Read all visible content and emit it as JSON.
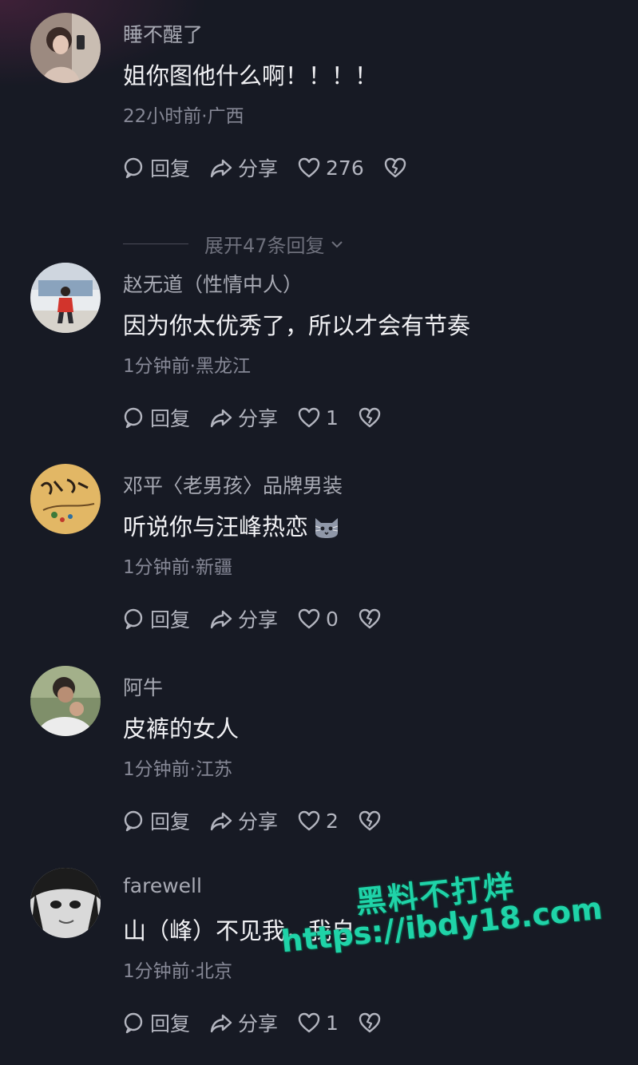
{
  "comments": [
    {
      "username": "睡不醒了",
      "content": "姐你图他什么啊！！！！",
      "meta": "22小时前·广西",
      "reply_label": "回复",
      "share_label": "分享",
      "likes": "276",
      "expand_label": "展开47条回复"
    },
    {
      "username": "赵无道（性情中人）",
      "content": "因为你太优秀了，所以才会有节奏",
      "meta": "1分钟前·黑龙江",
      "reply_label": "回复",
      "share_label": "分享",
      "likes": "1"
    },
    {
      "username": "邓平〈老男孩〉品牌男装",
      "content": "听说你与汪峰热恋",
      "meta": "1分钟前·新疆",
      "reply_label": "回复",
      "share_label": "分享",
      "likes": "0"
    },
    {
      "username": "阿牛",
      "content": "皮裤的女人",
      "meta": "1分钟前·江苏",
      "reply_label": "回复",
      "share_label": "分享",
      "likes": "2"
    },
    {
      "username": "farewell",
      "content": "山（峰）不见我，我自",
      "meta": "1分钟前·北京",
      "reply_label": "回复",
      "share_label": "分享",
      "likes": "1"
    }
  ],
  "watermark": {
    "title": "黑料不打烊",
    "url": "https://ibdy18.com"
  },
  "colors": {
    "background": "#171a24",
    "username": "#a8aab4",
    "content": "#f1f1f4",
    "meta": "#868896",
    "watermark": "#1fd3a8"
  }
}
